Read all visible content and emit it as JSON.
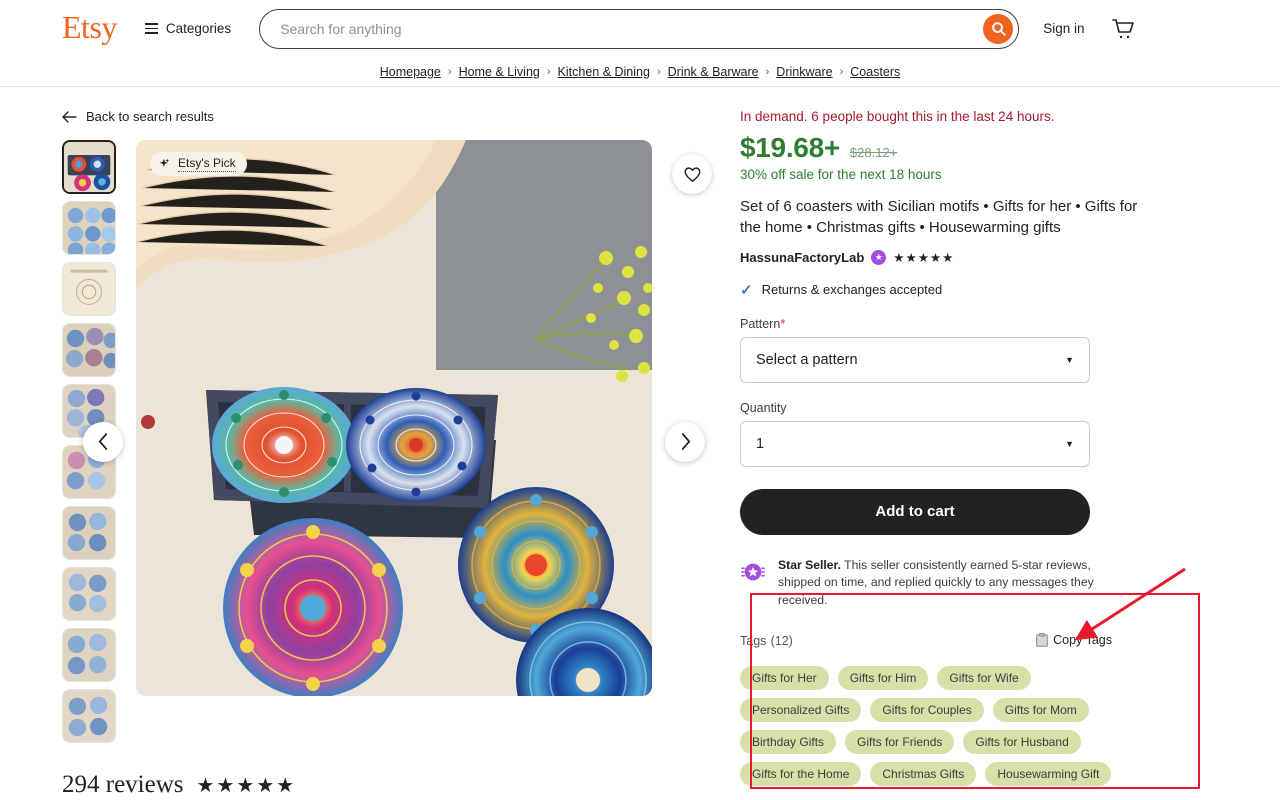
{
  "header": {
    "logo": "Etsy",
    "categories_label": "Categories",
    "search_placeholder": "Search for anything",
    "search_value": "",
    "search_icon": "search-icon",
    "signin_label": "Sign in",
    "cart_icon": "shopping-cart-icon"
  },
  "breadcrumb": {
    "items": [
      "Homepage",
      "Home & Living",
      "Kitchen & Dining",
      "Drink & Barware",
      "Drinkware",
      "Coasters"
    ],
    "separator": "›"
  },
  "gallery": {
    "back_label": "Back to search results",
    "etsy_pick_label": "Etsy's Pick",
    "favorite_icon": "heart-icon",
    "prev_icon": "chevron-left-icon",
    "next_icon": "chevron-right-icon",
    "selected_index": 0,
    "thumb_count": 10
  },
  "reviews": {
    "count_label": "294 reviews",
    "stars": 5,
    "star_glyph": "★"
  },
  "product": {
    "demand_note": "In demand. 6 people bought this in the last 24 hours.",
    "price": "$19.68+",
    "price_original": "$28.12+",
    "sale_note": "30% off sale for the next 18 hours",
    "title": "Set of 6 coasters with Sicilian motifs • Gifts for her • Gifts for the home • Christmas gifts • Housewarming gifts",
    "seller_name": "HassunaFactoryLab",
    "seller_badge_icon": "star-seller-badge-icon",
    "seller_stars": 5,
    "returns_label": "Returns & exchanges accepted",
    "check_icon": "check-icon"
  },
  "options": {
    "pattern_label": "Pattern",
    "pattern_required_mark": "*",
    "pattern_value": "Select a pattern",
    "quantity_label": "Quantity",
    "quantity_value": "1",
    "caret_icon": "chevron-down-icon",
    "add_to_cart_label": "Add to cart"
  },
  "star_seller": {
    "badge_icon": "star-seller-badge-icon",
    "title": "Star Seller.",
    "description": " This seller consistently earned 5-star reviews, shipped on time, and replied quickly to any messages they received."
  },
  "tags": {
    "title": "Tags",
    "count_label": "(12)",
    "copy_label": "Copy Tags",
    "copy_icon": "clipboard-icon",
    "items": [
      "Gifts for Her",
      "Gifts for Him",
      "Gifts for Wife",
      "Personalized Gifts",
      "Gifts for Couples",
      "Gifts for Mom",
      "Birthday Gifts",
      "Gifts for Friends",
      "Gifts for Husband",
      "Gifts for the Home",
      "Christmas Gifts",
      "Housewarming Gift"
    ]
  },
  "annotation": {
    "highlight_color": "#e8192c",
    "arrow_icon": "red-arrow-icon"
  },
  "colors": {
    "brand_orange": "#f1641e",
    "price_green": "#2e7d32",
    "demand_red": "#a61a2e",
    "tag_green": "#d7e0a9",
    "badge_purple": "#a34fde"
  }
}
